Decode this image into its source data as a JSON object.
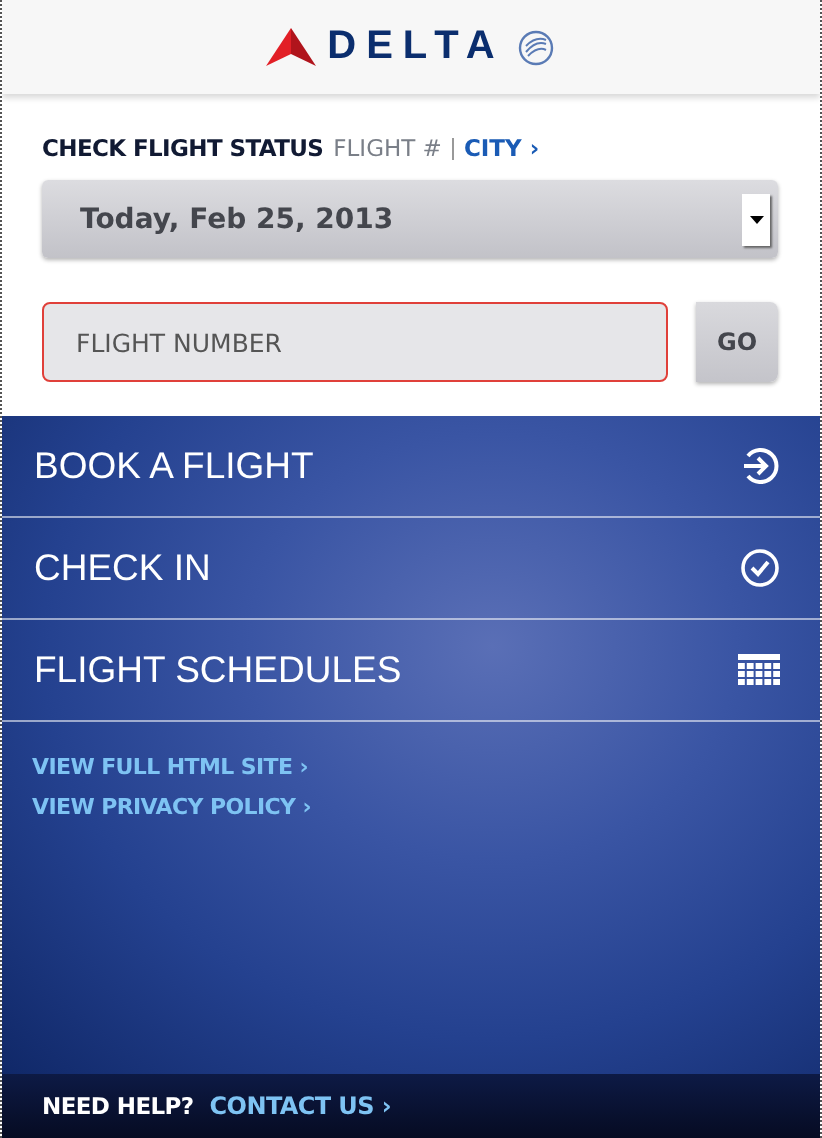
{
  "header": {
    "logo_text": "DELTA"
  },
  "flight_status": {
    "title": "CHECK FLIGHT STATUS",
    "modes": [
      {
        "label": "FLIGHT #",
        "selected": true
      },
      {
        "label": "CITY ›",
        "selected": false
      }
    ],
    "date": "Today, Feb 25, 2013",
    "flight_field": {
      "placeholder": "FLIGHT NUMBER",
      "invalid": true
    },
    "go_button": "GO"
  },
  "menu": [
    {
      "label": "BOOK A FLIGHT",
      "kind": "arrow"
    },
    {
      "label": "CHECK IN",
      "kind": "check"
    },
    {
      "label": "FLIGHT SCHEDULES",
      "kind": "grid"
    }
  ],
  "links": [
    "VIEW FULL HTML SITE ›",
    "VIEW PRIVACY POLICY ›"
  ],
  "footer": {
    "label": "NEED HELP?",
    "link": "CONTACT US ›"
  }
}
